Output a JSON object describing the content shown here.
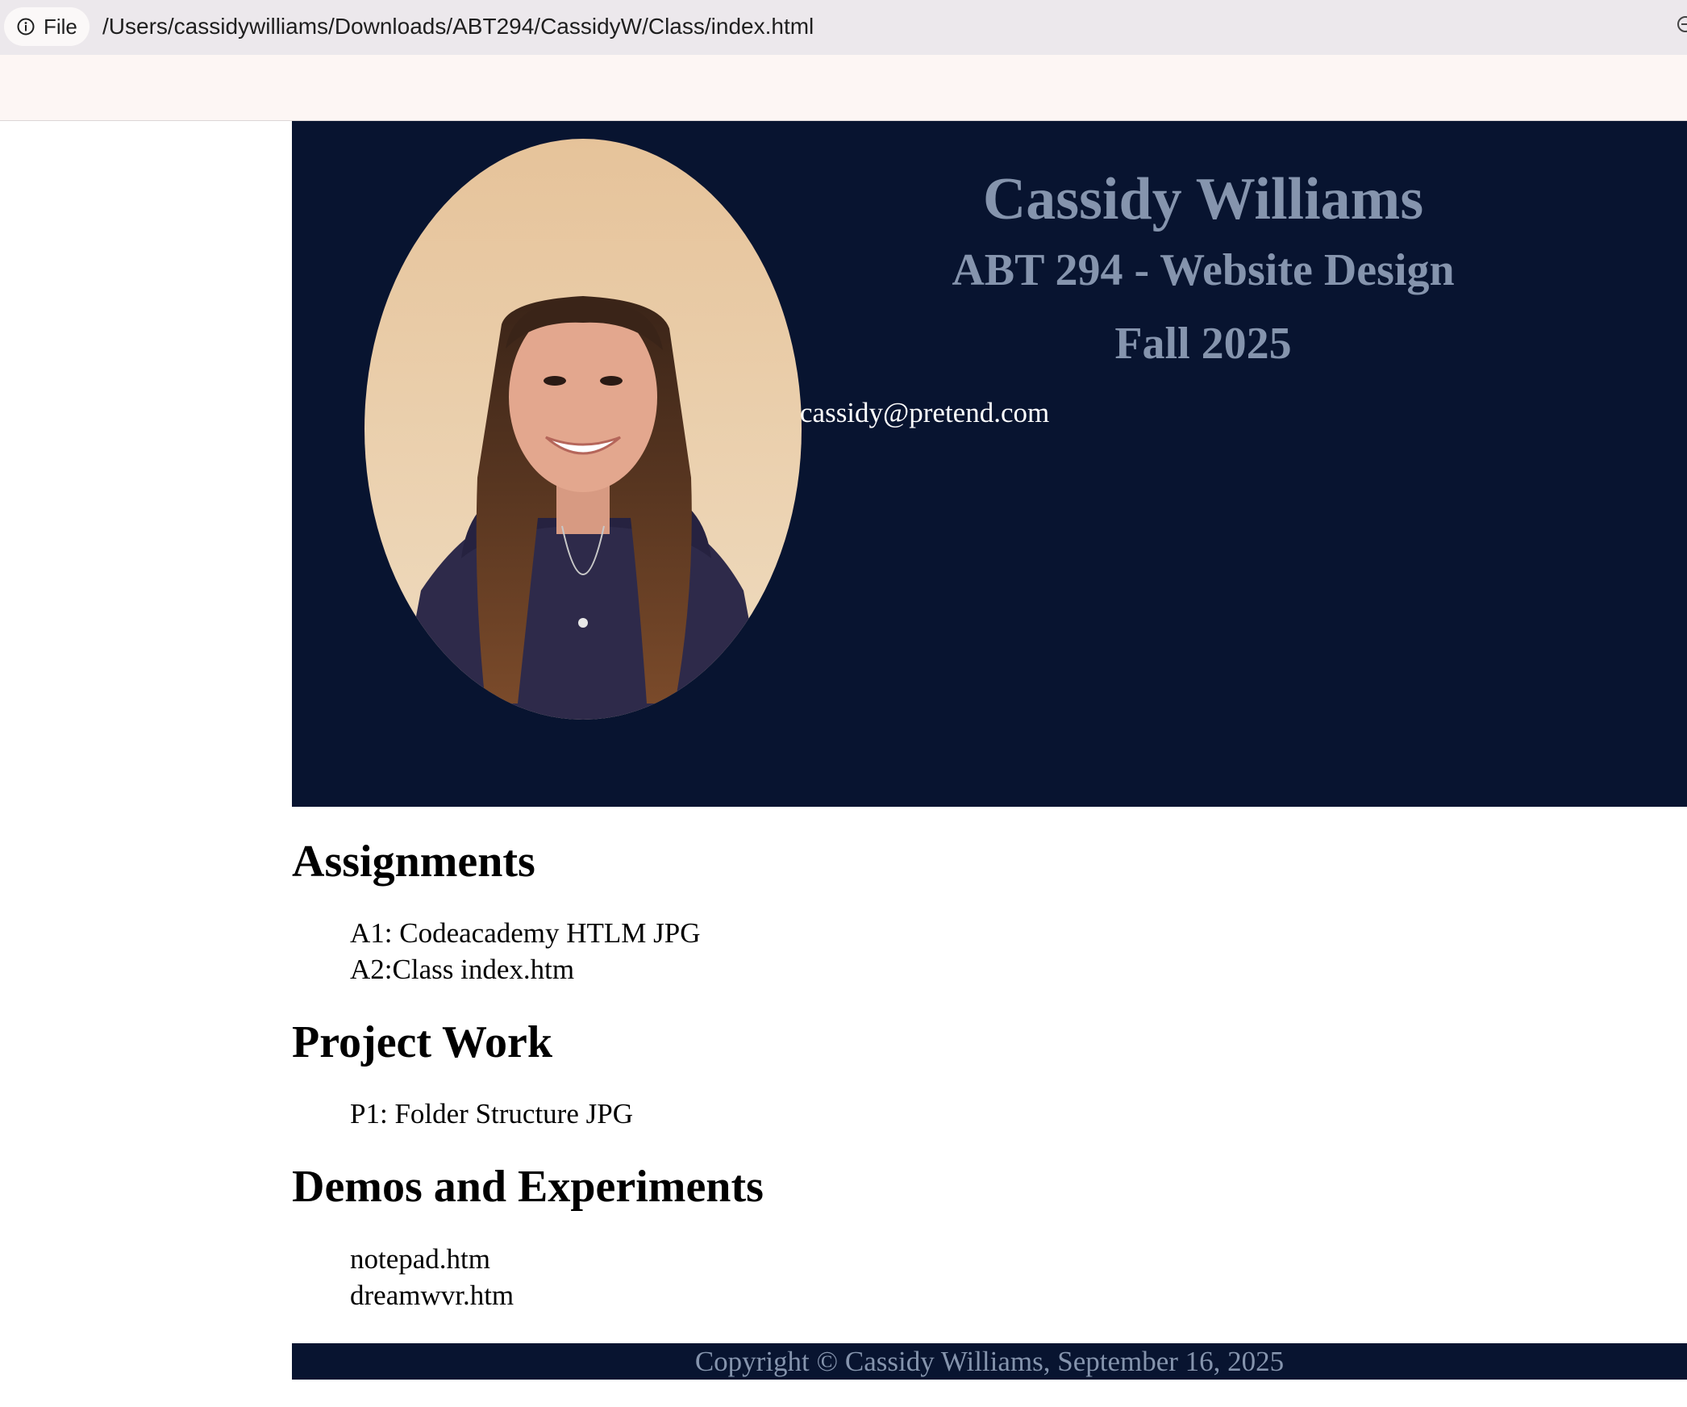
{
  "browser": {
    "scheme_label": "File",
    "url": "/Users/cassidywilliams/Downloads/ABT294/CassidyW/Class/index.html",
    "icons": [
      "info-icon",
      "zoom-icon"
    ]
  },
  "header": {
    "name": "Cassidy Williams",
    "course": "ABT 294 - Website Design",
    "term": "Fall 2025",
    "email": "cassidy@pretend.com",
    "background_color": "#081430",
    "heading_color": "#8594ad"
  },
  "sections": {
    "assignments": {
      "heading": "Assignments",
      "items": [
        "A1: Codeacademy HTLM JPG",
        "A2:Class index.htm"
      ]
    },
    "projects": {
      "heading": "Project Work",
      "items": [
        "P1: Folder Structure JPG"
      ]
    },
    "demos": {
      "heading": "Demos and Experiments",
      "items": [
        "notepad.htm",
        "dreamwvr.htm"
      ]
    }
  },
  "footer": {
    "text": "Copyright © Cassidy Williams, September 16, 2025"
  }
}
